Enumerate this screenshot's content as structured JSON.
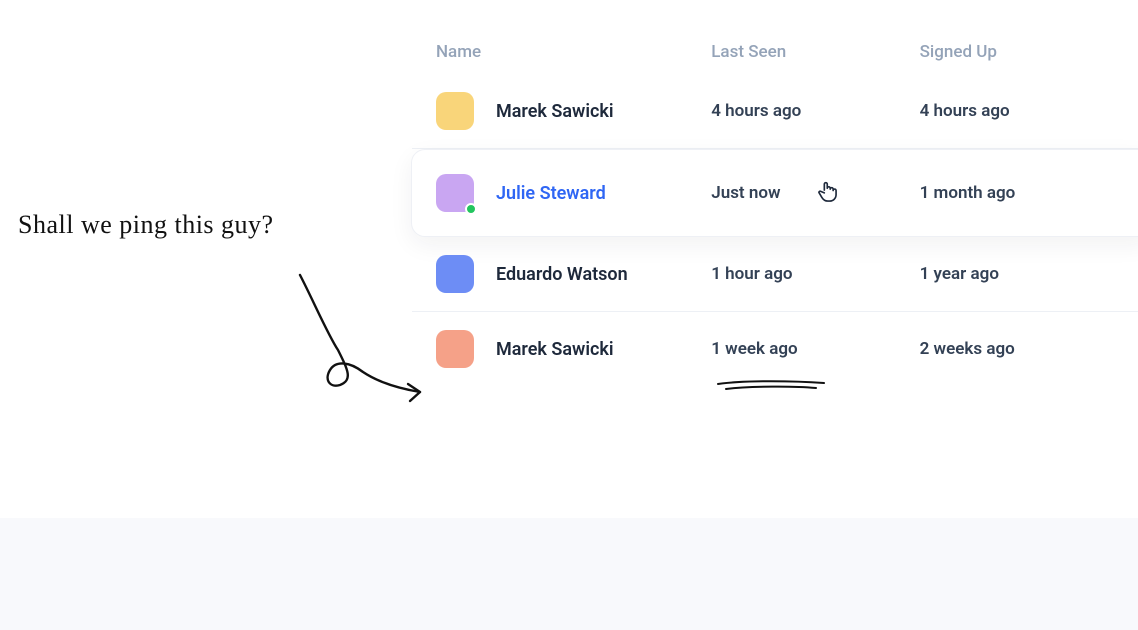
{
  "annotation": {
    "text": "Shall we ping this guy?"
  },
  "table": {
    "headers": {
      "name": "Name",
      "last_seen": "Last Seen",
      "signed_up": "Signed Up"
    },
    "rows": [
      {
        "name": "Marek Sawicki",
        "last_seen": "4 hours ago",
        "signed_up": "4 hours ago",
        "avatar_color": "yellow",
        "online": false
      },
      {
        "name": "Julie Steward",
        "last_seen": "Just now",
        "signed_up": "1 month ago",
        "avatar_color": "purple",
        "online": true
      },
      {
        "name": "Eduardo Watson",
        "last_seen": "1 hour ago",
        "signed_up": "1 year ago",
        "avatar_color": "blue",
        "online": false
      },
      {
        "name": "Marek Sawicki",
        "last_seen": "1 week ago",
        "signed_up": "2 weeks ago",
        "avatar_color": "orange",
        "online": false
      }
    ]
  }
}
